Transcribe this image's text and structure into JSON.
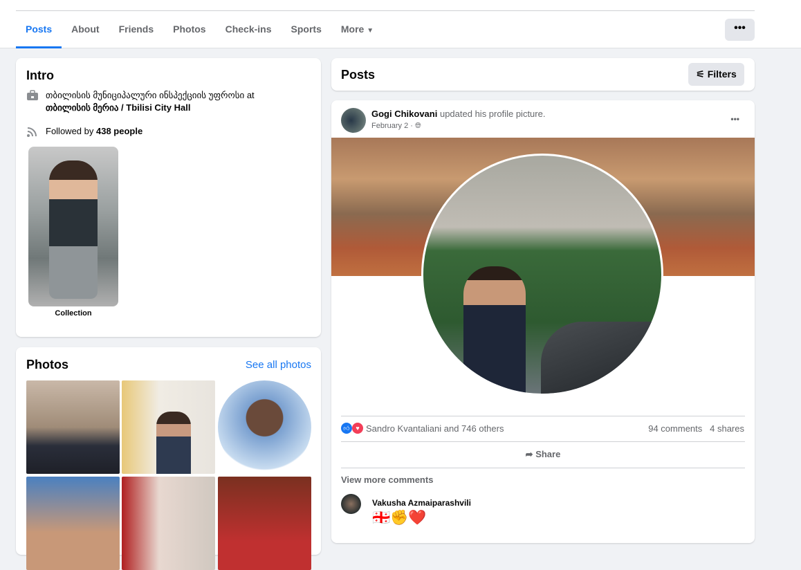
{
  "nav": {
    "tabs": [
      "Posts",
      "About",
      "Friends",
      "Photos",
      "Check-ins",
      "Sports",
      "More"
    ],
    "active": "Posts",
    "more_dots": "•••"
  },
  "intro": {
    "title": "Intro",
    "work_prefix": "თბილისის მუნიციპალური ინსპექციის უფროსი at",
    "work_place": "თბილისის მერია / Tbilisi City Hall",
    "followed_prefix": "Followed by",
    "followed_count": "438 people",
    "collection_label": "Collection"
  },
  "photos": {
    "title": "Photos",
    "see_all": "See all photos"
  },
  "posts": {
    "title": "Posts",
    "filters": "Filters"
  },
  "post": {
    "author": "Gogi Chikovani",
    "action": "updated his profile picture.",
    "date": "February 2 ·",
    "menu": "•••",
    "reactions": "Sandro Kvantaliani and 746 others",
    "comments": "94 comments",
    "shares": "4 shares",
    "share_label": "Share",
    "view_more": "View more comments",
    "comment": {
      "author": "Vakusha Azmaiparashvili",
      "text": "🇬🇪✊❤️"
    }
  },
  "colors": {
    "accent": "#1877f2",
    "bg": "#f0f2f5"
  }
}
